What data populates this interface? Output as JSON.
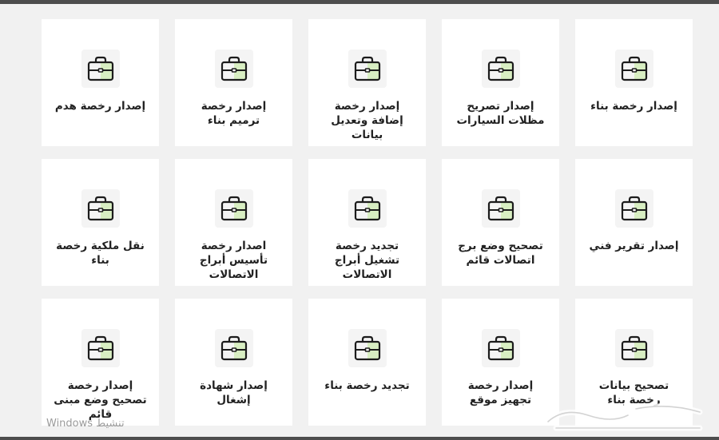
{
  "accent_color": "#d8eec2",
  "services": [
    {
      "label": "إصدار رخصة بناء",
      "icon": "briefcase-icon"
    },
    {
      "label": "إصدار تصريح مظلات السيارات",
      "icon": "briefcase-icon"
    },
    {
      "label": "إصدار رخصة إضافة وتعديل بيانات",
      "icon": "briefcase-icon"
    },
    {
      "label": "إصدار رخصة ترميم بناء",
      "icon": "briefcase-icon"
    },
    {
      "label": "إصدار رخصة هدم",
      "icon": "briefcase-icon"
    },
    {
      "label": "إصدار تقرير فني",
      "icon": "briefcase-icon"
    },
    {
      "label": "تصحيح وضع برج اتصالات قائم",
      "icon": "briefcase-icon"
    },
    {
      "label": "تجديد رخصة تشغيل أبراج الاتصالات",
      "icon": "briefcase-icon"
    },
    {
      "label": "اصدار رخصة تأسيس أبراج الاتصالات",
      "icon": "briefcase-icon"
    },
    {
      "label": "نقل ملكية رخصة بناء",
      "icon": "briefcase-icon"
    },
    {
      "label": "تصحيح بيانات رخصة بناء",
      "icon": "briefcase-icon"
    },
    {
      "label": "إصدار رخصة تجهيز موقع",
      "icon": "briefcase-icon"
    },
    {
      "label": "تجديد رخصة بناء",
      "icon": "briefcase-icon"
    },
    {
      "label": "إصدار شهادة إشغال",
      "icon": "briefcase-icon"
    },
    {
      "label": "إصدار رخصة تصحيح وضع مبنى قائم",
      "icon": "briefcase-icon"
    }
  ],
  "watermark": {
    "text": "Windows تنشيط"
  },
  "logo": {
    "name": "haraj-logo"
  }
}
